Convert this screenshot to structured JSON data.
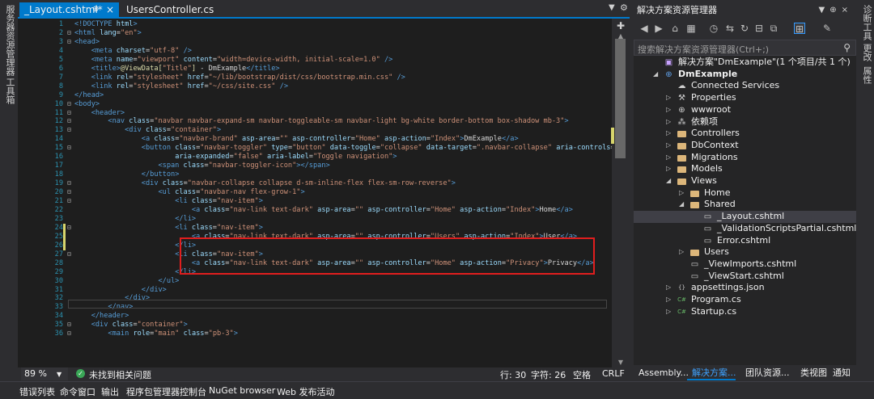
{
  "left_strip": {
    "tabs": [
      "服务器资源管理器",
      "工具箱"
    ]
  },
  "right_strip": {
    "tabs": [
      "诊断工具",
      "更改",
      "属性"
    ]
  },
  "editor": {
    "tabs": [
      {
        "label": "_Layout.cshtml*",
        "pin": "⊕",
        "close": "×",
        "active": true
      },
      {
        "label": "UsersController.cs",
        "active": false
      }
    ],
    "lines": [
      {
        "n": "1",
        "fold": "",
        "html": "<span class=\"t-tag\">&lt;!DOCTYPE</span> <span class=\"t-attr\">html</span><span class=\"t-tag\">&gt;</span>"
      },
      {
        "n": "2",
        "fold": "⊟",
        "html": "<span class=\"t-tag\">&lt;html</span> <span class=\"t-attr\">lang</span>=<span class=\"t-val\">\"en\"</span><span class=\"t-tag\">&gt;</span>"
      },
      {
        "n": "3",
        "fold": "⊟",
        "html": "<span class=\"t-tag\">&lt;head&gt;</span>"
      },
      {
        "n": "4",
        "fold": "",
        "html": "    <span class=\"t-tag\">&lt;meta</span> <span class=\"t-attr\">charset</span>=<span class=\"t-val\">\"utf-8\"</span> <span class=\"t-tag\">/&gt;</span>"
      },
      {
        "n": "5",
        "fold": "",
        "html": "    <span class=\"t-tag\">&lt;meta</span> <span class=\"t-attr\">name</span>=<span class=\"t-val\">\"viewport\"</span> <span class=\"t-attr\">content</span>=<span class=\"t-val\">\"width=device-width, initial-scale=1.0\"</span> <span class=\"t-tag\">/&gt;</span>"
      },
      {
        "n": "6",
        "fold": "",
        "html": "    <span class=\"t-tag\">&lt;title&gt;</span><span class=\"t-razor\">@ViewData[</span><span class=\"t-val\">\"Title\"</span><span class=\"t-razor\">]</span> - DmExample<span class=\"t-tag\">&lt;/title&gt;</span>"
      },
      {
        "n": "7",
        "fold": "",
        "html": "    <span class=\"t-tag\">&lt;link</span> <span class=\"t-attr\">rel</span>=<span class=\"t-val\">\"stylesheet\"</span> <span class=\"t-attr\">href</span>=<span class=\"t-val\">\"~/lib/bootstrap/dist/css/bootstrap.min.css\"</span> <span class=\"t-tag\">/&gt;</span>"
      },
      {
        "n": "8",
        "fold": "",
        "html": "    <span class=\"t-tag\">&lt;link</span> <span class=\"t-attr\">rel</span>=<span class=\"t-val\">\"stylesheet\"</span> <span class=\"t-attr\">href</span>=<span class=\"t-val\">\"~/css/site.css\"</span> <span class=\"t-tag\">/&gt;</span>"
      },
      {
        "n": "9",
        "fold": "",
        "html": "<span class=\"t-tag\">&lt;/head&gt;</span>"
      },
      {
        "n": "10",
        "fold": "⊟",
        "html": "<span class=\"t-tag\">&lt;body&gt;</span>"
      },
      {
        "n": "11",
        "fold": "⊟",
        "html": "    <span class=\"t-tag\">&lt;header&gt;</span>"
      },
      {
        "n": "12",
        "fold": "⊟",
        "html": "        <span class=\"t-tag\">&lt;nav</span> <span class=\"t-attr\">class</span>=<span class=\"t-val\">\"navbar navbar-expand-sm navbar-toggleable-sm navbar-light bg-white border-bottom box-shadow mb-3\"</span><span class=\"t-tag\">&gt;</span>"
      },
      {
        "n": "13",
        "fold": "⊟",
        "html": "            <span class=\"t-tag\">&lt;div</span> <span class=\"t-attr\">class</span>=<span class=\"t-val\">\"container\"</span><span class=\"t-tag\">&gt;</span>"
      },
      {
        "n": "14",
        "fold": "",
        "html": "                <span class=\"t-tag\">&lt;a</span> <span class=\"t-attr\">class</span>=<span class=\"t-val\">\"navbar-brand\"</span> <span class=\"t-attr\">asp-area</span>=<span class=\"t-val\">\"\"</span> <span class=\"t-attr\">asp-controller</span>=<span class=\"t-val\">\"Home\"</span> <span class=\"t-attr\">asp-action</span>=<span class=\"t-val\">\"Index\"</span><span class=\"t-tag\">&gt;</span>DmExample<span class=\"t-tag\">&lt;/a&gt;</span>"
      },
      {
        "n": "15",
        "fold": "⊟",
        "html": "                <span class=\"t-tag\">&lt;button</span> <span class=\"t-attr\">class</span>=<span class=\"t-val\">\"navbar-toggler\"</span> <span class=\"t-attr\">type</span>=<span class=\"t-val\">\"button\"</span> <span class=\"t-attr\">data-toggle</span>=<span class=\"t-val\">\"collapse\"</span> <span class=\"t-attr\">data-target</span>=<span class=\"t-val\">\".navbar-collapse\"</span> <span class=\"t-attr\">aria-controls</span>=<span class=\"t-val\">\"navba</span>"
      },
      {
        "n": "16",
        "fold": "",
        "html": "                        <span class=\"t-attr\">aria-expanded</span>=<span class=\"t-val\">\"false\"</span> <span class=\"t-attr\">aria-label</span>=<span class=\"t-val\">\"Toggle navigation\"</span><span class=\"t-tag\">&gt;</span>"
      },
      {
        "n": "17",
        "fold": "",
        "html": "                    <span class=\"t-tag\">&lt;span</span> <span class=\"t-attr\">class</span>=<span class=\"t-val\">\"navbar-toggler-icon\"</span><span class=\"t-tag\">&gt;&lt;/span&gt;</span>"
      },
      {
        "n": "18",
        "fold": "",
        "html": "                <span class=\"t-tag\">&lt;/button&gt;</span>"
      },
      {
        "n": "19",
        "fold": "⊟",
        "html": "                <span class=\"t-tag\">&lt;div</span> <span class=\"t-attr\">class</span>=<span class=\"t-val\">\"navbar-collapse collapse d-sm-inline-flex flex-sm-row-reverse\"</span><span class=\"t-tag\">&gt;</span>"
      },
      {
        "n": "20",
        "fold": "⊟",
        "html": "                    <span class=\"t-tag\">&lt;ul</span> <span class=\"t-attr\">class</span>=<span class=\"t-val\">\"navbar-nav flex-grow-1\"</span><span class=\"t-tag\">&gt;</span>"
      },
      {
        "n": "21",
        "fold": "⊟",
        "html": "                        <span class=\"t-tag\">&lt;li</span> <span class=\"t-attr\">class</span>=<span class=\"t-val\">\"nav-item\"</span><span class=\"t-tag\">&gt;</span>"
      },
      {
        "n": "22",
        "fold": "",
        "html": "                            <span class=\"t-tag\">&lt;a</span> <span class=\"t-attr\">class</span>=<span class=\"t-val\">\"nav-link text-dark\"</span> <span class=\"t-attr\">asp-area</span>=<span class=\"t-val\">\"\"</span> <span class=\"t-attr\">asp-controller</span>=<span class=\"t-val\">\"Home\"</span> <span class=\"t-attr\">asp-action</span>=<span class=\"t-val\">\"Index\"</span><span class=\"t-tag\">&gt;</span>Home<span class=\"t-tag\">&lt;/a&gt;</span>"
      },
      {
        "n": "23",
        "fold": "",
        "html": "                        <span class=\"t-tag\">&lt;/li&gt;</span>"
      },
      {
        "n": "24",
        "fold": "⊟",
        "html": "                        <span class=\"t-tag\">&lt;li</span> <span class=\"t-attr\">class</span>=<span class=\"t-val\">\"nav-item\"</span><span class=\"t-tag\">&gt;</span>"
      },
      {
        "n": "25",
        "fold": "",
        "html": "                            <span class=\"t-tag\">&lt;a</span> <span class=\"t-attr\">class</span>=<span class=\"t-val\">\"nav-link text-dark\"</span> <span class=\"t-attr\">asp-area</span>=<span class=\"t-val\">\"\"</span> <span class=\"t-attr\">asp-controller</span>=<span class=\"t-val\">\"Users\"</span> <span class=\"t-attr\">asp-action</span>=<span class=\"t-val\">\"Index\"</span><span class=\"t-tag\">&gt;</span>User<span class=\"t-tag\">&lt;/a&gt;</span>"
      },
      {
        "n": "26",
        "fold": "",
        "html": "                        <span class=\"t-tag\">&lt;/li&gt;</span>"
      },
      {
        "n": "27",
        "fold": "⊟",
        "html": "                        <span class=\"t-tag\">&lt;li</span> <span class=\"t-attr\">class</span>=<span class=\"t-val\">\"nav-item\"</span><span class=\"t-tag\">&gt;</span>"
      },
      {
        "n": "28",
        "fold": "",
        "html": "                            <span class=\"t-tag\">&lt;a</span> <span class=\"t-attr\">class</span>=<span class=\"t-val\">\"nav-link text-dark\"</span> <span class=\"t-attr\">asp-area</span>=<span class=\"t-val\">\"\"</span> <span class=\"t-attr\">asp-controller</span>=<span class=\"t-val\">\"Home\"</span> <span class=\"t-attr\">asp-action</span>=<span class=\"t-val\">\"Privacy\"</span><span class=\"t-tag\">&gt;</span>Privacy<span class=\"t-tag\">&lt;/a&gt;</span>"
      },
      {
        "n": "29",
        "fold": "",
        "html": "                        <span class=\"t-tag\">&lt;/li&gt;</span>"
      },
      {
        "n": "30",
        "fold": "",
        "html": "                    <span class=\"t-tag\">&lt;/ul&gt;</span>"
      },
      {
        "n": "31",
        "fold": "",
        "html": "                <span class=\"t-tag\">&lt;/div&gt;</span>"
      },
      {
        "n": "32",
        "fold": "",
        "html": "            <span class=\"t-tag\">&lt;/div&gt;</span>"
      },
      {
        "n": "33",
        "fold": "",
        "html": "        <span class=\"t-tag\">&lt;/nav&gt;</span>"
      },
      {
        "n": "34",
        "fold": "",
        "html": "    <span class=\"t-tag\">&lt;/header&gt;</span>"
      },
      {
        "n": "35",
        "fold": "⊟",
        "html": "    <span class=\"t-tag\">&lt;div</span> <span class=\"t-attr\">class</span>=<span class=\"t-val\">\"container\"</span><span class=\"t-tag\">&gt;</span>"
      },
      {
        "n": "36",
        "fold": "⊟",
        "html": "        <span class=\"t-tag\">&lt;main</span> <span class=\"t-attr\">role</span>=<span class=\"t-val\">\"main\"</span> <span class=\"t-attr\">class</span>=<span class=\"t-val\">\"pb-3\"</span><span class=\"t-tag\">&gt;</span>"
      }
    ],
    "modified_lines": [
      "24",
      "25",
      "26"
    ],
    "status": {
      "zoom": "89 %",
      "issues": "未找到相关问题",
      "line": "行: 30",
      "char": "字符: 26",
      "spaces": "空格",
      "eol": "CRLF"
    }
  },
  "solution_explorer": {
    "title": "解决方案资源管理器",
    "search_placeholder": "搜索解决方案资源管理器(Ctrl+;)",
    "tree": [
      {
        "label": "解决方案\"DmExample\"(1 个项目/共 1 个)",
        "depth": 0,
        "arrow": "",
        "icon": "solution",
        "bold": false
      },
      {
        "label": "DmExample",
        "depth": 0,
        "arrow": "◢",
        "icon": "project",
        "bold": true
      },
      {
        "label": "Connected Services",
        "depth": 1,
        "arrow": "",
        "icon": "service"
      },
      {
        "label": "Properties",
        "depth": 1,
        "arrow": "▷",
        "icon": "wrench"
      },
      {
        "label": "wwwroot",
        "depth": 1,
        "arrow": "▷",
        "icon": "globe"
      },
      {
        "label": "依赖项",
        "depth": 1,
        "arrow": "▷",
        "icon": "dependency"
      },
      {
        "label": "Controllers",
        "depth": 1,
        "arrow": "▷",
        "icon": "folder"
      },
      {
        "label": "DbContext",
        "depth": 1,
        "arrow": "▷",
        "icon": "folder"
      },
      {
        "label": "Migrations",
        "depth": 1,
        "arrow": "▷",
        "icon": "folder"
      },
      {
        "label": "Models",
        "depth": 1,
        "arrow": "▷",
        "icon": "folder"
      },
      {
        "label": "Views",
        "depth": 1,
        "arrow": "◢",
        "icon": "folder-open"
      },
      {
        "label": "Home",
        "depth": 2,
        "arrow": "▷",
        "icon": "folder"
      },
      {
        "label": "Shared",
        "depth": 2,
        "arrow": "◢",
        "icon": "folder-open"
      },
      {
        "label": "_Layout.cshtml",
        "depth": 3,
        "arrow": "",
        "icon": "file",
        "selected": true
      },
      {
        "label": "_ValidationScriptsPartial.cshtml",
        "depth": 3,
        "arrow": "",
        "icon": "file"
      },
      {
        "label": "Error.cshtml",
        "depth": 3,
        "arrow": "",
        "icon": "file"
      },
      {
        "label": "Users",
        "depth": 2,
        "arrow": "▷",
        "icon": "folder"
      },
      {
        "label": "_ViewImports.cshtml",
        "depth": 2,
        "arrow": "",
        "icon": "file"
      },
      {
        "label": "_ViewStart.cshtml",
        "depth": 2,
        "arrow": "",
        "icon": "file"
      },
      {
        "label": "appsettings.json",
        "depth": 1,
        "arrow": "▷",
        "icon": "json"
      },
      {
        "label": "Program.cs",
        "depth": 1,
        "arrow": "▷",
        "icon": "csharp"
      },
      {
        "label": "Startup.cs",
        "depth": 1,
        "arrow": "▷",
        "icon": "csharp"
      }
    ],
    "bottom_tabs": [
      "Assembly...",
      "解决方案...",
      "团队资源...",
      "类视图",
      "通知"
    ]
  },
  "bottom_bar": {
    "items": [
      "错误列表",
      "命令窗口",
      "输出",
      "程序包管理器控制台",
      "NuGet browser",
      "Web 发布活动"
    ]
  },
  "colors": {
    "accent": "#007acc",
    "highlight_box": "#e01e1e",
    "modified_marker": "#d7d56c",
    "tag": "#569cd6",
    "attr": "#9cdcfe",
    "value": "#ce9178",
    "line_number": "#2b91af"
  }
}
